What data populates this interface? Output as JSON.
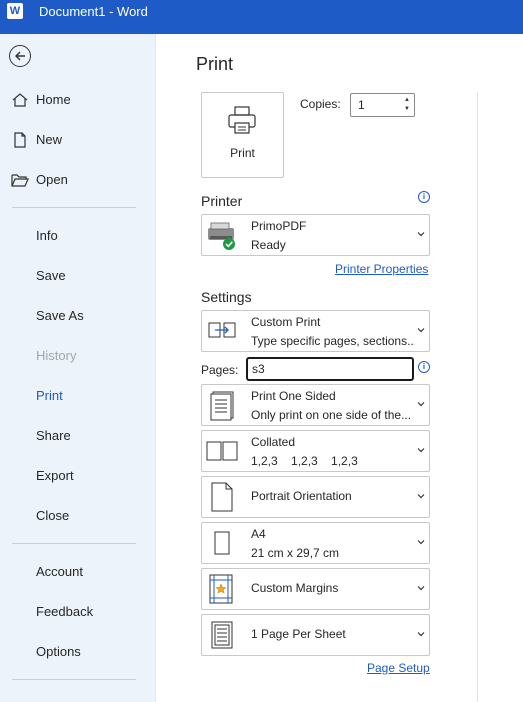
{
  "titlebar": {
    "logo": "W",
    "title": "Document1  -  Word",
    "accent": "#1f5bc7"
  },
  "sidebar": {
    "back_icon": "back-arrow-icon",
    "items": [
      {
        "label": "Home",
        "icon": "home-icon"
      },
      {
        "label": "New",
        "icon": "new-document-icon"
      },
      {
        "label": "Open",
        "icon": "folder-open-icon"
      },
      {
        "label": "Info"
      },
      {
        "label": "Save"
      },
      {
        "label": "Save As"
      },
      {
        "label": "History",
        "disabled": true
      },
      {
        "label": "Print",
        "active": true
      },
      {
        "label": "Share"
      },
      {
        "label": "Export"
      },
      {
        "label": "Close"
      },
      {
        "label": "Account"
      },
      {
        "label": "Feedback"
      },
      {
        "label": "Options"
      }
    ]
  },
  "main": {
    "heading": "Print",
    "print_button": {
      "label": "Print",
      "icon": "printer-icon"
    },
    "copies": {
      "label": "Copies:",
      "value": "1"
    },
    "printer": {
      "heading": "Printer",
      "name": "PrimoPDF",
      "status": "Ready",
      "properties_link": "Printer Properties"
    },
    "settings": {
      "heading": "Settings",
      "range": {
        "title": "Custom Print",
        "subtitle": "Type specific pages, sections..."
      },
      "pages": {
        "label": "Pages:",
        "value": "s3"
      },
      "sides": {
        "title": "Print One Sided",
        "subtitle": "Only print on one side of the..."
      },
      "collation": {
        "title": "Collated",
        "subtitle": "1,2,3    1,2,3    1,2,3"
      },
      "orientation": {
        "title": "Portrait Orientation"
      },
      "paper": {
        "title": "A4",
        "subtitle": "21 cm x 29,7 cm"
      },
      "margins": {
        "title": "Custom Margins"
      },
      "per_sheet": {
        "title": "1 Page Per Sheet"
      },
      "page_setup_link": "Page Setup"
    }
  }
}
